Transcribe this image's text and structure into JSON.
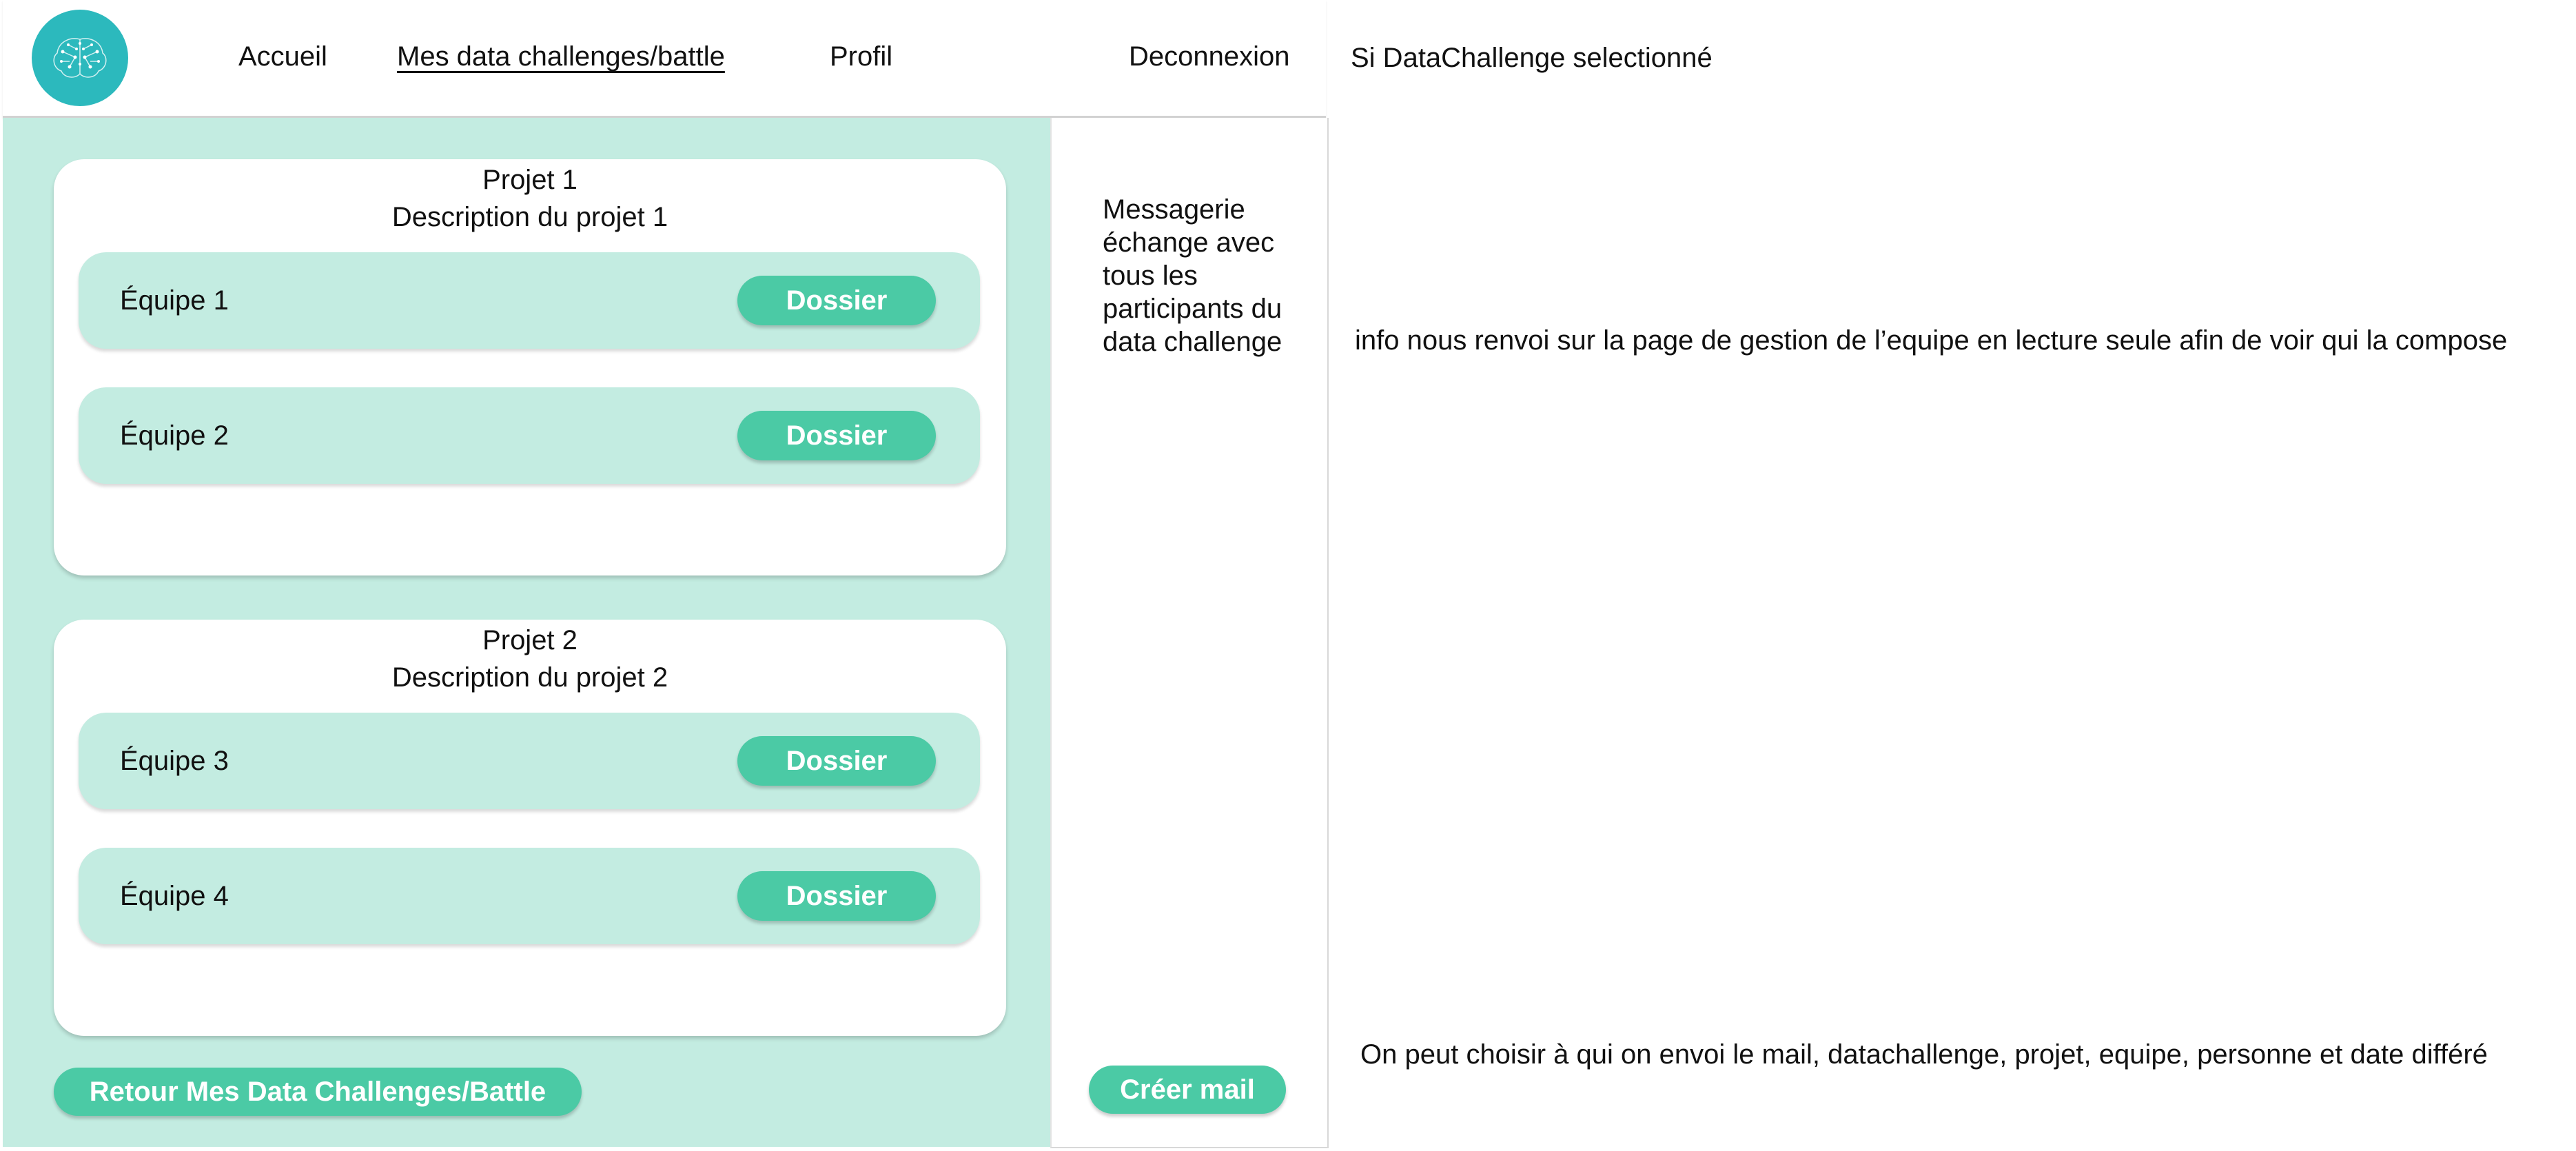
{
  "header": {
    "logo_icon": "brain-network-icon",
    "nav": {
      "home": "Accueil",
      "my_challenges": "Mes data challenges/battle",
      "profile": "Profil",
      "logout": "Deconnexion"
    }
  },
  "projects": [
    {
      "name": "Projet 1",
      "description": "Description du projet 1",
      "teams": [
        {
          "label": "Équipe 1",
          "button": "Dossier"
        },
        {
          "label": "Équipe 2",
          "button": "Dossier"
        }
      ]
    },
    {
      "name": "Projet 2",
      "description": "Description du projet 2",
      "teams": [
        {
          "label": "Équipe 3",
          "button": "Dossier"
        },
        {
          "label": "Équipe 4",
          "button": "Dossier"
        }
      ]
    }
  ],
  "back_button": "Retour Mes Data Challenges/Battle",
  "messaging": {
    "description": "Messagerie échange avec tous les participants du data challenge",
    "create_mail_button": "Créer mail"
  },
  "notes": {
    "selected": "Si DataChallenge selectionné",
    "info": "info nous renvoi sur la page de gestion de l’equipe en lecture seule afin de voir qui la compose",
    "mail": "On peut choisir à qui on envoi le mail, datachallenge, projet, equipe, personne et date différé"
  },
  "colors": {
    "accent": "#4bcaa5",
    "mint_background": "#c3ece1",
    "logo": "#2cb9bd"
  }
}
